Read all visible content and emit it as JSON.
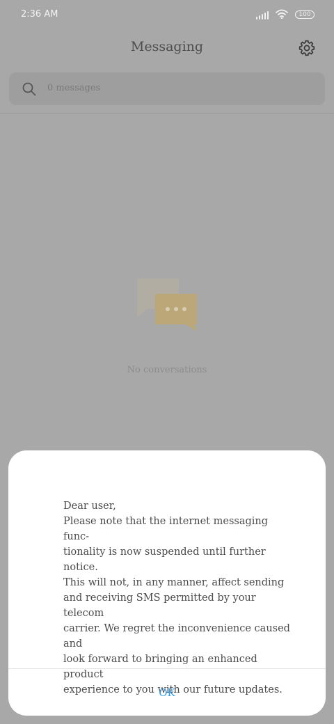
{
  "status_bar": {
    "time": "2:36 AM",
    "battery": "100",
    "icons": [
      "signal-icon",
      "wifi-icon",
      "battery-icon"
    ]
  },
  "header": {
    "title": "Messaging",
    "settings_icon": "gear-icon"
  },
  "search": {
    "placeholder": "0 messages",
    "icon": "search-icon"
  },
  "empty_state": {
    "icon": "chat-bubbles-icon",
    "text": "No conversations"
  },
  "dialog": {
    "message": "Dear user,\nPlease note that the internet messaging func-\ntionality is now suspended until further notice.\nThis will not, in any manner, affect sending\nand receiving SMS permitted by your telecom\ncarrier. We regret the inconvenience caused and\nlook forward to bringing an enhanced product\nexperience to you with our future updates.",
    "ok_label": "OK"
  },
  "colors": {
    "overlay_background": "#a8a8a8",
    "dialog_background": "#ffffff",
    "accent": "#2d9cf0",
    "text_primary": "#4b4b4b"
  }
}
